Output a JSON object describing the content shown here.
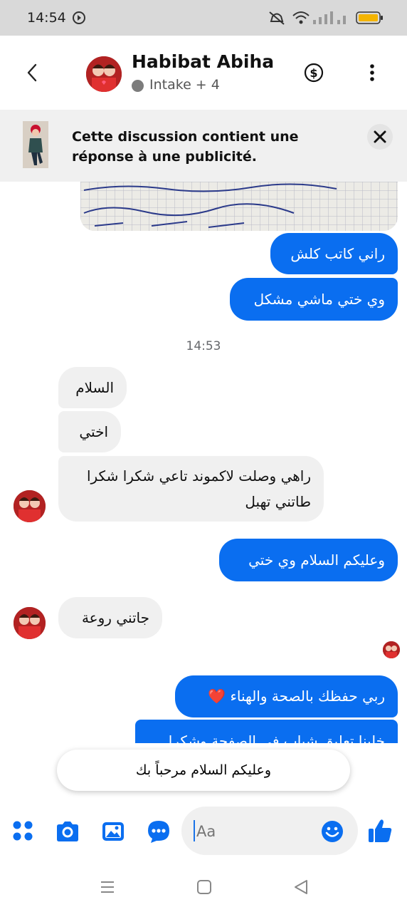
{
  "status_bar": {
    "time": "14:54"
  },
  "header": {
    "contact_name": "Habibat Abiha",
    "subtitle": "Intake + 4",
    "back_icon": "back-arrow-icon",
    "payment_icon": "dollar-circle-icon",
    "menu_icon": "more-vertical-icon"
  },
  "banner": {
    "text": "Cette discussion contient une réponse à une publicité."
  },
  "messages": [
    {
      "dir": "out",
      "text": "راني كاتب كلش"
    },
    {
      "dir": "out",
      "text": "وي ختي ماشي مشكل"
    },
    {
      "dir": "in",
      "text": "السلام"
    },
    {
      "dir": "in",
      "text": "اختي"
    },
    {
      "dir": "in",
      "text": "راهي وصلت لاكموند تاعي شكرا شكرا طاتني تهبل"
    },
    {
      "dir": "out",
      "text": "وعليكم السلام وي ختي"
    },
    {
      "dir": "in",
      "text": "جاتني روعة"
    },
    {
      "dir": "out",
      "text": "ربي حفظك بالصحة والهناء ❤️"
    },
    {
      "dir": "out",
      "text": "خلينا تعليق شباب في الصفحة وشكرا"
    }
  ],
  "time_separator": "14:53",
  "suggested_reply": "وعليكم السلام مرحباً بك",
  "composer": {
    "placeholder": "Aa"
  },
  "colors": {
    "accent": "#0a6ef0",
    "incoming_bubble": "#f0f0f0"
  }
}
